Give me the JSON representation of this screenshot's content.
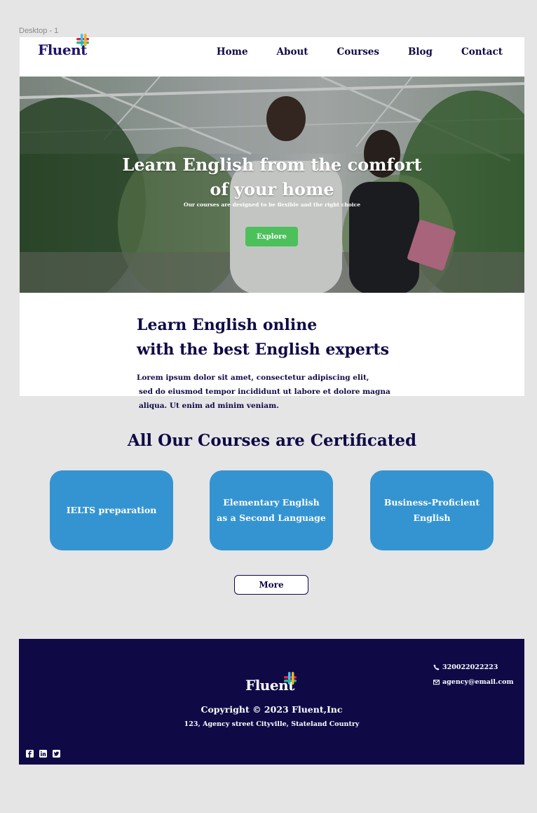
{
  "frame": {
    "label": "Desktop - 1"
  },
  "nav": {
    "logo": "Fluent",
    "links": [
      "Home",
      "About",
      "Courses",
      "Blog",
      "Contact"
    ]
  },
  "hero": {
    "title_line1": "Learn English from the comfort",
    "title_line2": "of your home",
    "subtitle": "Our courses are designed to be flexible and the right choice",
    "cta": "Explore"
  },
  "intro": {
    "title_line1": "Learn English online",
    "title_line2": "with the best English experts",
    "body_lines": [
      "Lorem ipsum dolor sit amet, consectetur adipiscing elit,",
      "sed do eiusmod tempor incididunt ut labore et dolore magna",
      "aliqua. Ut enim ad minim veniam."
    ]
  },
  "courses": {
    "title": "All Our Courses are Certificated",
    "cards": [
      {
        "line1": "IELTS preparation",
        "line2": ""
      },
      {
        "line1": "Elementary English",
        "line2": "as a Second Language"
      },
      {
        "line1": "Business-Proficient",
        "line2": "English"
      }
    ],
    "more": "More"
  },
  "footer": {
    "logo": "Fluent",
    "copyright": "Copyright © 2023 Fluent,Inc",
    "address": "123, Agency street Cityville, Stateland Country",
    "phone": "320022022223",
    "email": "agency@email.com",
    "social_icons": [
      "facebook-icon",
      "linkedin-icon",
      "twitter-icon"
    ]
  },
  "colors": {
    "navy": "#0f0a46",
    "card_blue": "#3494d1",
    "cta_green": "#4cc05a",
    "canvas": "#e5e5e5"
  }
}
